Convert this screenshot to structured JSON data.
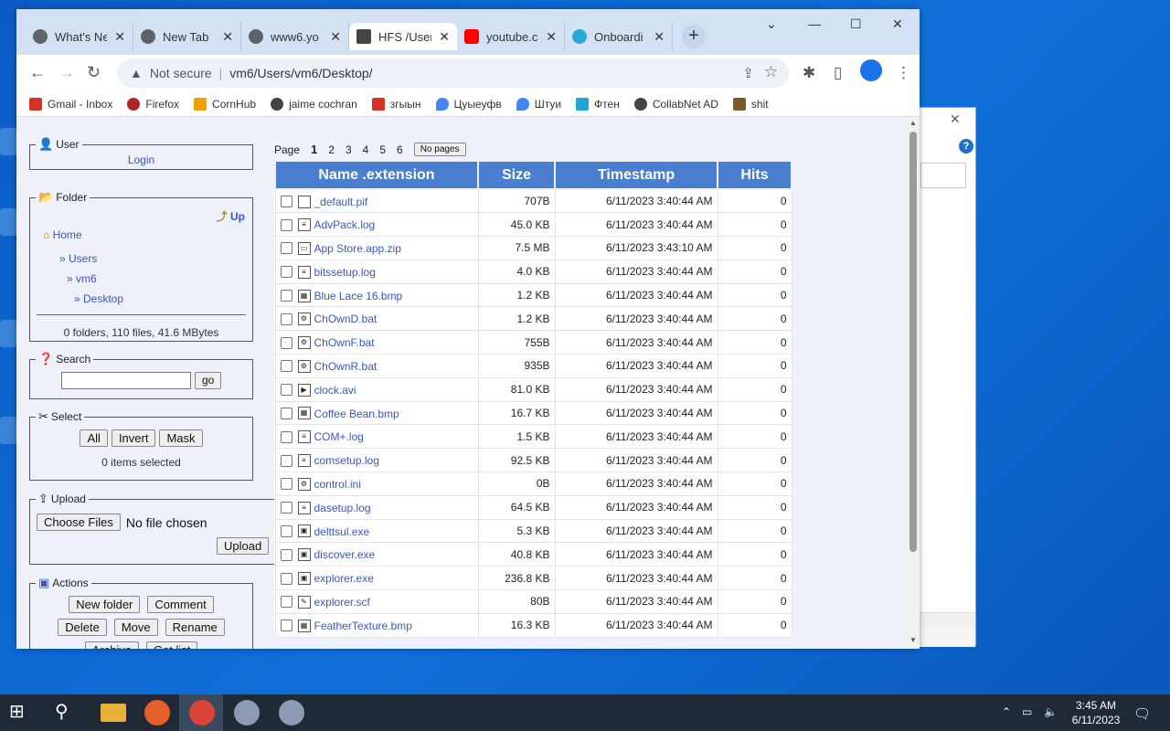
{
  "browser": {
    "tabs": [
      {
        "label": "What's Ne",
        "color": "#5f6368"
      },
      {
        "label": "New Tab",
        "color": "#5f6368"
      },
      {
        "label": "www6.yo",
        "color": "#5f6368"
      },
      {
        "label": "HFS /User",
        "color": "#444"
      },
      {
        "label": "youtube.c",
        "color": "#ff0000"
      },
      {
        "label": "Onboardi",
        "color": "#2aa7d6"
      }
    ],
    "url": {
      "warning": "Not secure",
      "separator": "|",
      "path": "vm6/Users/vm6/Desktop/"
    },
    "bookmarks": [
      {
        "label": "Gmail - Inbox",
        "color": "#d93025"
      },
      {
        "label": "Firefox",
        "color": "#b22222"
      },
      {
        "label": "CornHub",
        "color": "#f0a000"
      },
      {
        "label": "jaime cochran",
        "color": "#444"
      },
      {
        "label": "згыын",
        "color": "#d93025"
      },
      {
        "label": "Цуыеуфв",
        "color": "#4285f4"
      },
      {
        "label": "Штуи",
        "color": "#4285f4"
      },
      {
        "label": "Фтен",
        "color": "#1fa3d8"
      },
      {
        "label": "CollabNet AD",
        "color": "#444"
      },
      {
        "label": "shit",
        "color": "#7a5b2a"
      }
    ]
  },
  "sidebar": {
    "user": {
      "legend": "User",
      "login": "Login"
    },
    "folder": {
      "legend": "Folder",
      "up": "Up",
      "home": "Home",
      "path": [
        "» Users",
        "» vm6",
        "» Desktop"
      ],
      "summary": "0 folders, 110 files, 41.6 MBytes"
    },
    "search": {
      "legend": "Search",
      "value": "",
      "go": "go"
    },
    "select": {
      "legend": "Select",
      "all": "All",
      "invert": "Invert",
      "mask": "Mask",
      "status": "0 items selected"
    },
    "upload": {
      "legend": "Upload",
      "choose": "Choose Files",
      "no_file": "No file chosen",
      "upload": "Upload"
    },
    "actions": {
      "legend": "Actions",
      "new_folder": "New folder",
      "comment": "Comment",
      "delete": "Delete",
      "move": "Move",
      "rename": "Rename",
      "archive": "Archive",
      "get_list": "Get list"
    }
  },
  "pager": {
    "label": "Page",
    "current": "1",
    "pages": [
      "2",
      "3",
      "4",
      "5",
      "6"
    ],
    "no_pages": "No pages"
  },
  "table": {
    "headers": [
      "Name .extension",
      "Size",
      "Timestamp",
      "Hits"
    ],
    "rows": [
      {
        "name": "_default.pif",
        "size": "707B",
        "ts": "6/11/2023 3:40:44 AM",
        "hits": "0",
        "icon": "blank"
      },
      {
        "name": "AdvPack.log",
        "size": "45.0 KB",
        "ts": "6/11/2023 3:40:44 AM",
        "hits": "0",
        "icon": "text"
      },
      {
        "name": "App Store.app.zip",
        "size": "7.5 MB",
        "ts": "6/11/2023 3:43:10 AM",
        "hits": "0",
        "icon": "zip"
      },
      {
        "name": "bitssetup.log",
        "size": "4.0 KB",
        "ts": "6/11/2023 3:40:44 AM",
        "hits": "0",
        "icon": "text"
      },
      {
        "name": "Blue Lace 16.bmp",
        "size": "1.2 KB",
        "ts": "6/11/2023 3:40:44 AM",
        "hits": "0",
        "icon": "image"
      },
      {
        "name": "ChOwnD.bat",
        "size": "1.2 KB",
        "ts": "6/11/2023 3:40:44 AM",
        "hits": "0",
        "icon": "bat"
      },
      {
        "name": "ChOwnF.bat",
        "size": "755B",
        "ts": "6/11/2023 3:40:44 AM",
        "hits": "0",
        "icon": "bat"
      },
      {
        "name": "ChOwnR.bat",
        "size": "935B",
        "ts": "6/11/2023 3:40:44 AM",
        "hits": "0",
        "icon": "bat"
      },
      {
        "name": "clock.avi",
        "size": "81.0 KB",
        "ts": "6/11/2023 3:40:44 AM",
        "hits": "0",
        "icon": "video"
      },
      {
        "name": "Coffee Bean.bmp",
        "size": "16.7 KB",
        "ts": "6/11/2023 3:40:44 AM",
        "hits": "0",
        "icon": "image"
      },
      {
        "name": "COM+.log",
        "size": "1.5 KB",
        "ts": "6/11/2023 3:40:44 AM",
        "hits": "0",
        "icon": "text"
      },
      {
        "name": "comsetup.log",
        "size": "92.5 KB",
        "ts": "6/11/2023 3:40:44 AM",
        "hits": "0",
        "icon": "text"
      },
      {
        "name": "control.ini",
        "size": "0B",
        "ts": "6/11/2023 3:40:44 AM",
        "hits": "0",
        "icon": "ini"
      },
      {
        "name": "dasetup.log",
        "size": "64.5 KB",
        "ts": "6/11/2023 3:40:44 AM",
        "hits": "0",
        "icon": "text"
      },
      {
        "name": "delttsul.exe",
        "size": "5.3 KB",
        "ts": "6/11/2023 3:40:44 AM",
        "hits": "0",
        "icon": "exe"
      },
      {
        "name": "discover.exe",
        "size": "40.8 KB",
        "ts": "6/11/2023 3:40:44 AM",
        "hits": "0",
        "icon": "exe"
      },
      {
        "name": "explorer.exe",
        "size": "236.8 KB",
        "ts": "6/11/2023 3:40:44 AM",
        "hits": "0",
        "icon": "exe"
      },
      {
        "name": "explorer.scf",
        "size": "80B",
        "ts": "6/11/2023 3:40:44 AM",
        "hits": "0",
        "icon": "scf"
      },
      {
        "name": "FeatherTexture.bmp",
        "size": "16.3 KB",
        "ts": "6/11/2023 3:40:44 AM",
        "hits": "0",
        "icon": "image"
      }
    ]
  },
  "taskbar": {
    "time": "3:45 AM",
    "date": "6/11/2023",
    "notifications": "1"
  },
  "colors": {
    "header": "#4a7fd0",
    "link": "#3a56c2",
    "page_bg": "#eef0fa"
  }
}
